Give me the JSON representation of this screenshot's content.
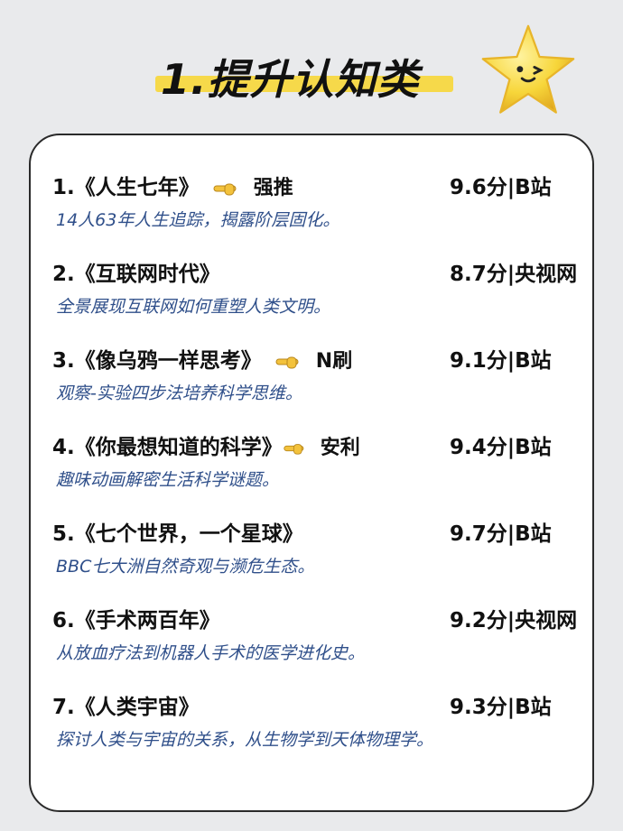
{
  "header": {
    "title": "1.提升认知类"
  },
  "colors": {
    "highlight": "#f6d94a",
    "desc_text": "#2f4f8a",
    "star": "#f7d63a"
  },
  "items": [
    {
      "title": "1.《人生七年》",
      "tag": "强推",
      "score": "9.6分|B站",
      "desc": "14人63年人生追踪，揭露阶层固化。"
    },
    {
      "title": "2.《互联网时代》",
      "tag": "",
      "score": "8.7分|央视网",
      "desc": "全景展现互联网如何重塑人类文明。"
    },
    {
      "title": "3.《像乌鸦一样思考》",
      "tag": "N刷",
      "score": "9.1分|B站",
      "desc": "观察-实验四步法培养科学思维。"
    },
    {
      "title": "4.《你最想知道的科学》",
      "tag": "安利",
      "score": "9.4分|B站",
      "desc": "趣味动画解密生活科学谜题。"
    },
    {
      "title": "5.《七个世界，一个星球》",
      "tag": "",
      "score": "9.7分|B站",
      "desc": "BBC七大洲自然奇观与濒危生态。"
    },
    {
      "title": "6.《手术两百年》",
      "tag": "",
      "score": "9.2分|央视网",
      "desc": "从放血疗法到机器人手术的医学进化史。"
    },
    {
      "title": "7.《人类宇宙》",
      "tag": "",
      "score": "9.3分|B站",
      "desc": "探讨人类与宇宙的关系，从生物学到天体物理学。"
    }
  ]
}
